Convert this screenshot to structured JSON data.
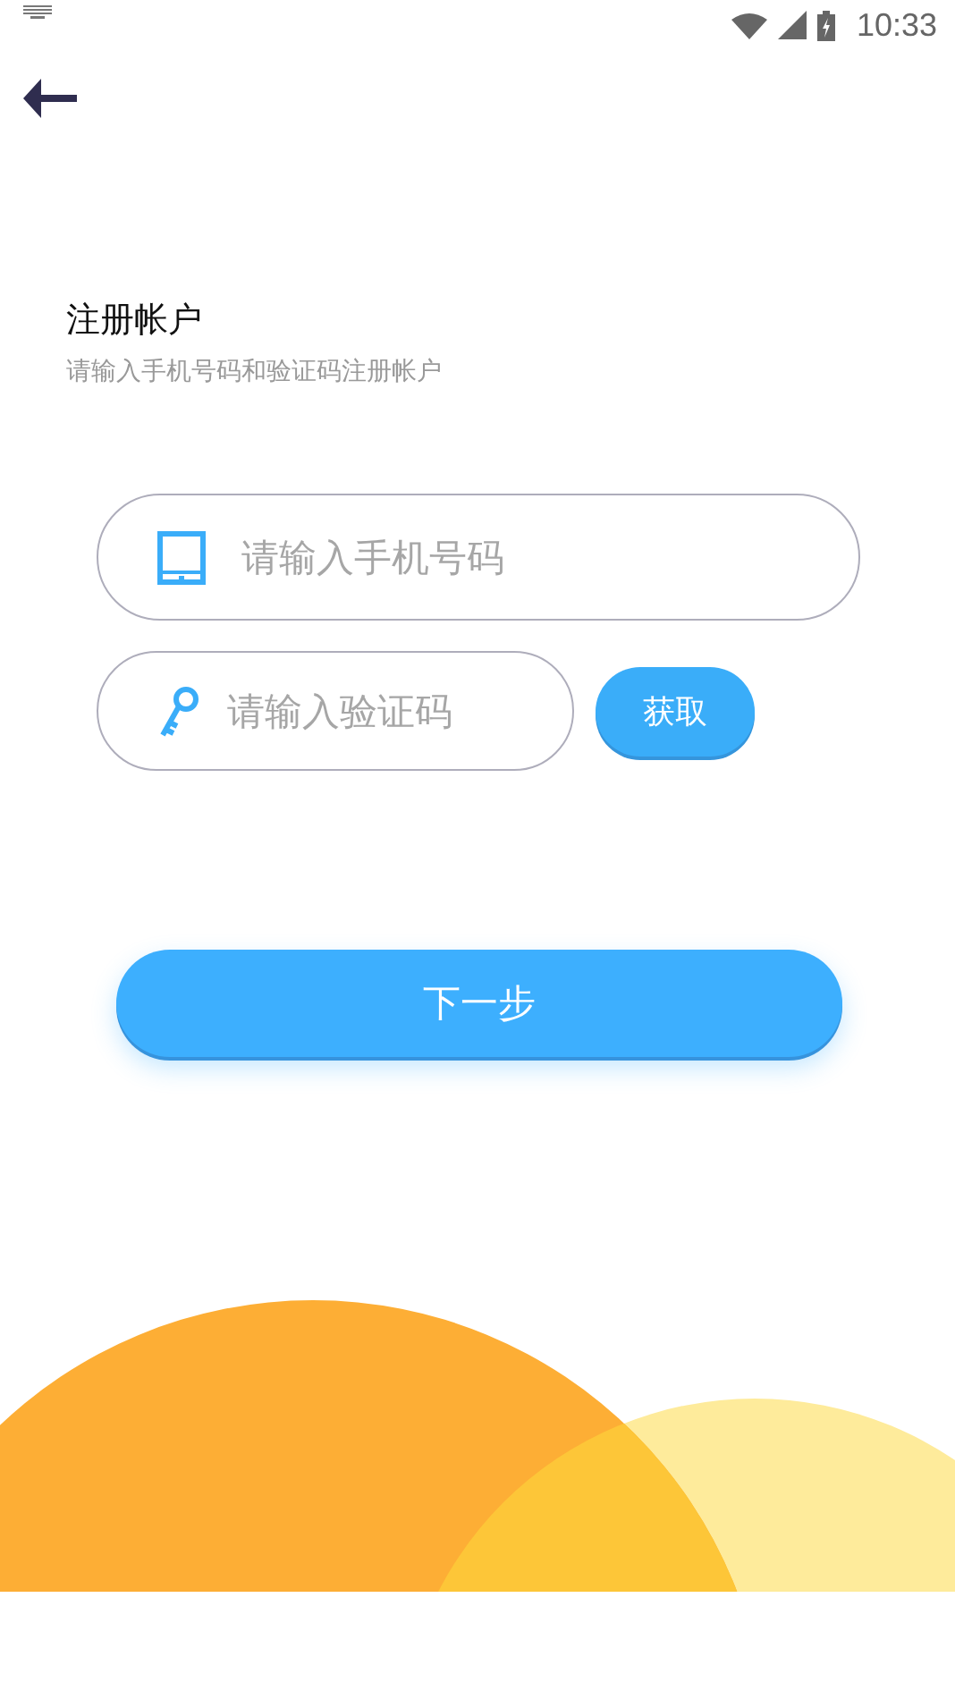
{
  "status_bar": {
    "time": "10:33"
  },
  "header": {
    "title": "注册帐户",
    "subtitle": "请输入手机号码和验证码注册帐户"
  },
  "form": {
    "phone": {
      "placeholder": "请输入手机号码"
    },
    "code": {
      "placeholder": "请输入验证码"
    },
    "get_code_button": "获取"
  },
  "next_button": "下一步"
}
